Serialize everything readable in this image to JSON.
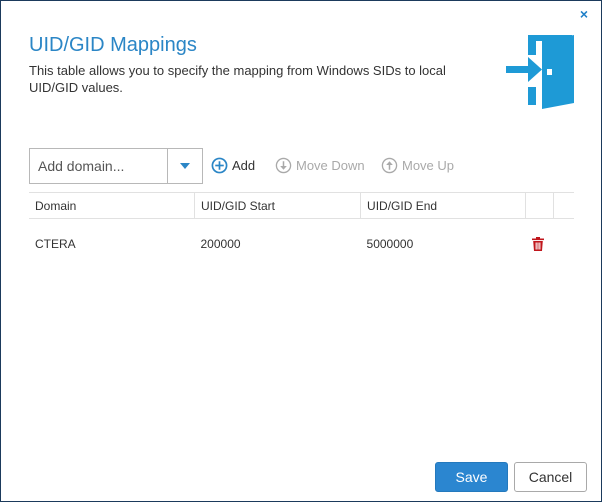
{
  "dialog": {
    "title": "UID/GID Mappings",
    "description": "This table allows you to specify the mapping from Windows SIDs to local UID/GID values.",
    "close_label": "×"
  },
  "domain_select": {
    "placeholder": "Add domain...",
    "value": ""
  },
  "toolbar": {
    "add_label": "Add",
    "move_down_label": "Move Down",
    "move_up_label": "Move Up"
  },
  "table": {
    "columns": [
      "Domain",
      "UID/GID Start",
      "UID/GID End"
    ],
    "rows": [
      {
        "domain": "CTERA",
        "start": "200000",
        "end": "5000000"
      }
    ]
  },
  "buttons": {
    "save_label": "Save",
    "cancel_label": "Cancel"
  },
  "colors": {
    "accent": "#2b86c6",
    "save_bg": "#2b86d0",
    "delete": "#c0161c",
    "disabled": "#a9a9a9"
  },
  "icons": {
    "header": "enter-door-icon",
    "add": "plus-circle-icon",
    "move_down": "arrow-down-circle-icon",
    "move_up": "arrow-up-circle-icon",
    "delete": "trash-icon",
    "dropdown": "caret-down-icon",
    "close": "close-icon"
  }
}
